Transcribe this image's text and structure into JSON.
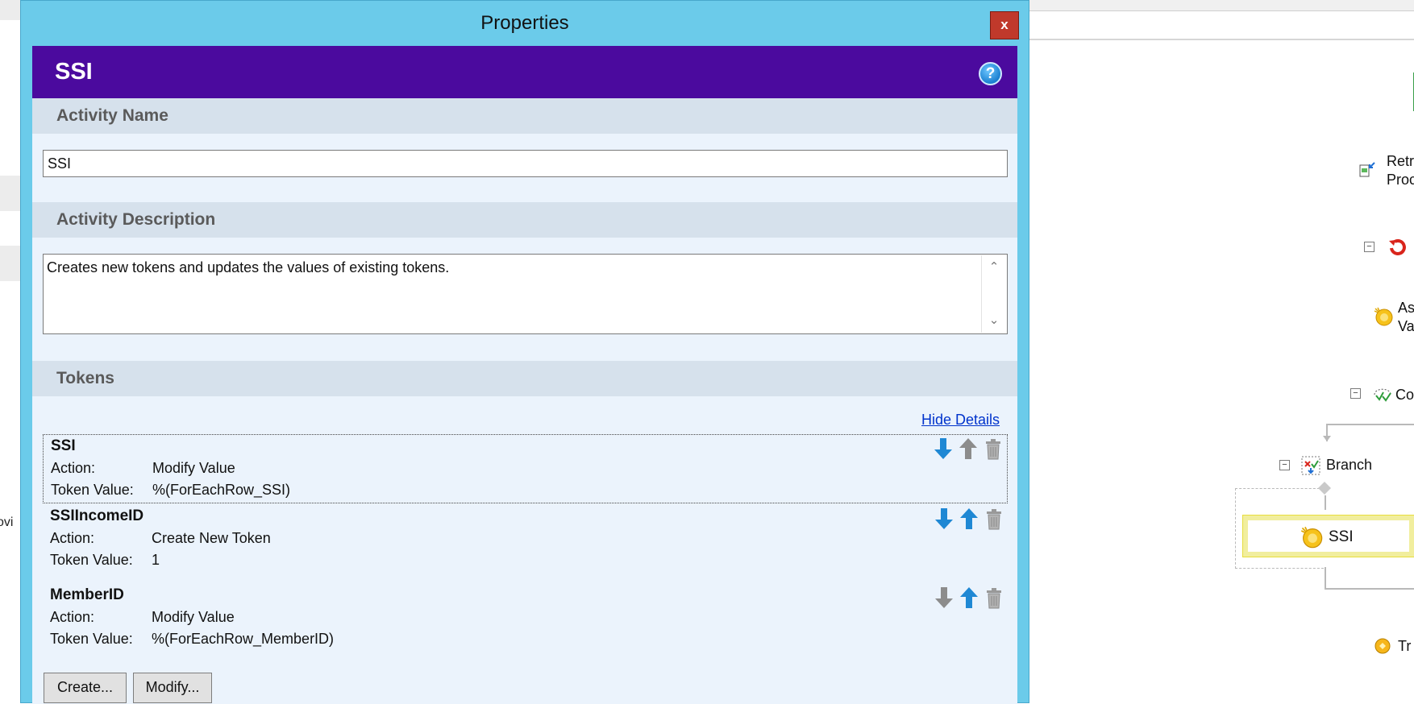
{
  "dialog": {
    "title": "Properties",
    "close_label": "x",
    "header_title": "SSI",
    "help_label": "?",
    "activity_name": {
      "section_label": "Activity Name",
      "value": "SSI"
    },
    "activity_description": {
      "section_label": "Activity Description",
      "value": "Creates new tokens and updates the values of existing tokens."
    },
    "tokens": {
      "section_label": "Tokens",
      "hide_details_label": "Hide Details",
      "action_label": "Action:",
      "value_label": "Token Value:",
      "items": [
        {
          "name": "SSI",
          "action": "Modify Value",
          "value": "%(ForEachRow_SSI)",
          "selected": true
        },
        {
          "name": "SSIIncomeID",
          "action": "Create New Token",
          "value": "1",
          "selected": false
        },
        {
          "name": "MemberID",
          "action": "Modify Value",
          "value": "%(ForEachRow_MemberID)",
          "selected": false
        }
      ]
    },
    "buttons": {
      "create_label": "Create...",
      "modify_label": "Modify..."
    }
  },
  "designer": {
    "retrieve_label_1": "Retr",
    "retrieve_label_2": "Proc",
    "assign_label_1": "As",
    "assign_label_2": "Va",
    "condition_label": "Co",
    "branch_label": "Branch",
    "ssi_label": "SSI",
    "tr_label": "Tr"
  },
  "left_app": {
    "cut_text": "ovi"
  },
  "colors": {
    "dialog_frame": "#6bcbea",
    "header_bg": "#4b0a9e",
    "content_bg": "#ebf3fc",
    "section_bg": "#d6e1ec",
    "close_bg": "#c0392b",
    "arrow_blue": "#1f88d4",
    "arrow_gray": "#8c8c8c",
    "link": "#0033cc",
    "selection_yellow": "#f1ee9e"
  }
}
